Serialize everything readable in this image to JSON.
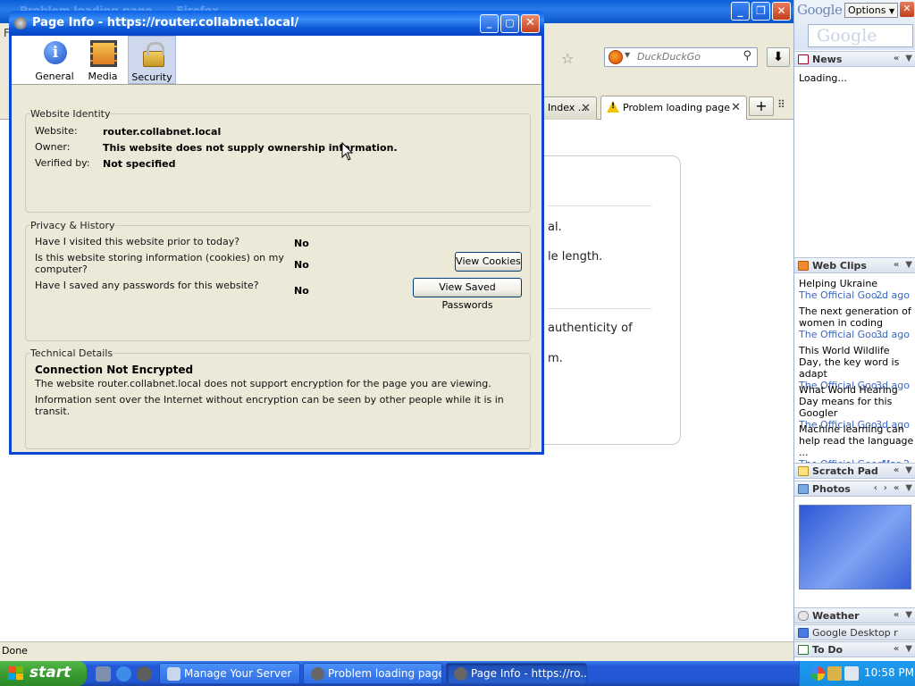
{
  "browser": {
    "window_title": "Problem loading page - ...Firefox",
    "menu_hint": "F",
    "search_placeholder": "DuckDuckGo",
    "tabs": [
      {
        "label": "Index ..."
      },
      {
        "label": "Problem loading page"
      }
    ],
    "error_fragments": [
      "al.",
      "le length.",
      "authenticity of",
      "m."
    ],
    "status": "Done"
  },
  "sidebar": {
    "logo": "Google",
    "options_label": "Options",
    "search_logo": "Google",
    "news": {
      "title": "News",
      "loading": "Loading..."
    },
    "web_clips": {
      "title": "Web Clips",
      "items": [
        {
          "title": "Helping Ukraine",
          "source": "The Official Goo...",
          "date": "2d ago"
        },
        {
          "title": "The next generation of women in coding",
          "source": "The Official Goo...",
          "date": "3d ago"
        },
        {
          "title": "This World Wildlife Day, the key word is adapt",
          "source": "The Official Goo...",
          "date": "3d ago"
        },
        {
          "title": "What World Hearing Day means for this Googler",
          "source": "The Official Goo...",
          "date": "3d ago"
        },
        {
          "title": "Machine learning can help read the language ...",
          "source": "The Official Googl...",
          "date": "Mar 2"
        }
      ]
    },
    "scratch_pad": {
      "title": "Scratch Pad"
    },
    "photos": {
      "title": "Photos"
    },
    "weather": {
      "title": "Weather"
    },
    "gd_item": {
      "title": "Google Desktop r"
    },
    "todo": {
      "title": "To Do"
    }
  },
  "dialog": {
    "title": "Page Info - https://router.collabnet.local/",
    "tabs": [
      {
        "label": "General",
        "icon": "info-icon"
      },
      {
        "label": "Media",
        "icon": "media-icon"
      },
      {
        "label": "Security",
        "icon": "lock-icon",
        "selected": true
      }
    ],
    "identity": {
      "legend": "Website Identity",
      "website_label": "Website:",
      "website_value": "router.collabnet.local",
      "owner_label": "Owner:",
      "owner_value": "This website does not supply ownership information.",
      "verified_label": "Verified by:",
      "verified_value": "Not specified"
    },
    "privacy": {
      "legend": "Privacy & History",
      "q1": "Have I visited this website prior to today?",
      "a1": "No",
      "q2a": "Is this website storing information (cookies) on my",
      "q2b": "computer?",
      "a2": "No",
      "q3": "Have I saved any passwords for this website?",
      "a3": "No",
      "view_cookies": "View Cookies",
      "view_passwords": "View Saved Passwords"
    },
    "technical": {
      "legend": "Technical Details",
      "heading": "Connection Not Encrypted",
      "line1": "The website router.collabnet.local does not support encryption for the page you are viewing.",
      "line2": "Information sent over the Internet without encryption can be seen by other people while it is in transit."
    }
  },
  "taskbar": {
    "start_label": "start",
    "tasks": [
      {
        "label": "Manage Your Server"
      },
      {
        "label": "Problem loading page..."
      },
      {
        "label": "Page Info - https://ro...",
        "active": true
      }
    ],
    "clock": "10:58 PM"
  },
  "colors": {
    "xp_blue": "#0a48d2",
    "start_green": "#3a9b32",
    "clip_link": "#3a67c2"
  }
}
